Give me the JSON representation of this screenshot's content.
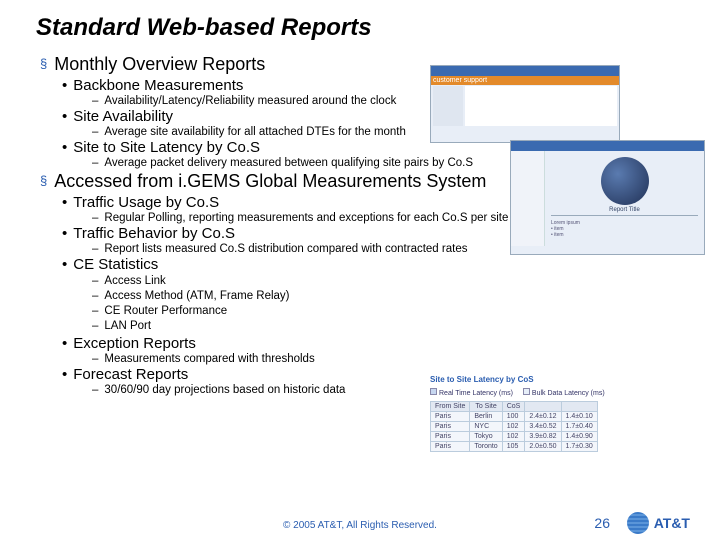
{
  "title": "Standard Web-based Reports",
  "sections": [
    {
      "heading": "Monthly Overview Reports",
      "bullets": [
        {
          "text": "Backbone Measurements",
          "subs": [
            "Availability/Latency/Reliability measured around the clock"
          ]
        },
        {
          "text": "Site Availability",
          "subs": [
            "Average site availability for all attached DTEs for the month"
          ]
        },
        {
          "text": "Site to Site Latency by Co.S",
          "subs": [
            "Average packet delivery measured between qualifying site pairs by Co.S"
          ]
        }
      ]
    },
    {
      "heading": "Accessed from i.GEMS Global Measurements System",
      "bullets": [
        {
          "text": "Traffic Usage by Co.S",
          "subs": [
            "Regular Polling, reporting measurements and exceptions for each Co.S per site connection"
          ]
        },
        {
          "text": "Traffic Behavior by Co.S",
          "subs": [
            "Report lists measured Co.S distribution compared with contracted rates"
          ]
        },
        {
          "text": "CE Statistics",
          "subs2": [
            "Access Link",
            "Access Method  (ATM, Frame Relay)",
            "CE Router Performance",
            "LAN Port"
          ]
        },
        {
          "text": "Exception Reports",
          "subs": [
            "Measurements compared with thresholds"
          ]
        },
        {
          "text": "Forecast Reports",
          "subs": [
            "30/60/90 day projections based on historic data"
          ]
        }
      ]
    }
  ],
  "thumb1": {
    "banner": "customer support"
  },
  "thumb3": {
    "title": "Site to Site Latency by CoS",
    "legend": [
      "Real Time Latency (ms)",
      "Bulk Data Latency (ms)"
    ],
    "headers": [
      "From Site",
      "To Site",
      "CoS",
      "",
      ""
    ],
    "rows": [
      [
        "Paris",
        "Berlin",
        "100",
        "2.4±0.12",
        "1.4±0.10"
      ],
      [
        "Paris",
        "NYC",
        "102",
        "3.4±0.52",
        "1.7±0.40"
      ],
      [
        "Paris",
        "Tokyo",
        "102",
        "3.9±0.82",
        "1.4±0.90"
      ],
      [
        "Paris",
        "Toronto",
        "105",
        "2.0±0.50",
        "1.7±0.30"
      ]
    ]
  },
  "footer": "© 2005 AT&T, All Rights Reserved.",
  "page": "26",
  "brand": "AT&T"
}
